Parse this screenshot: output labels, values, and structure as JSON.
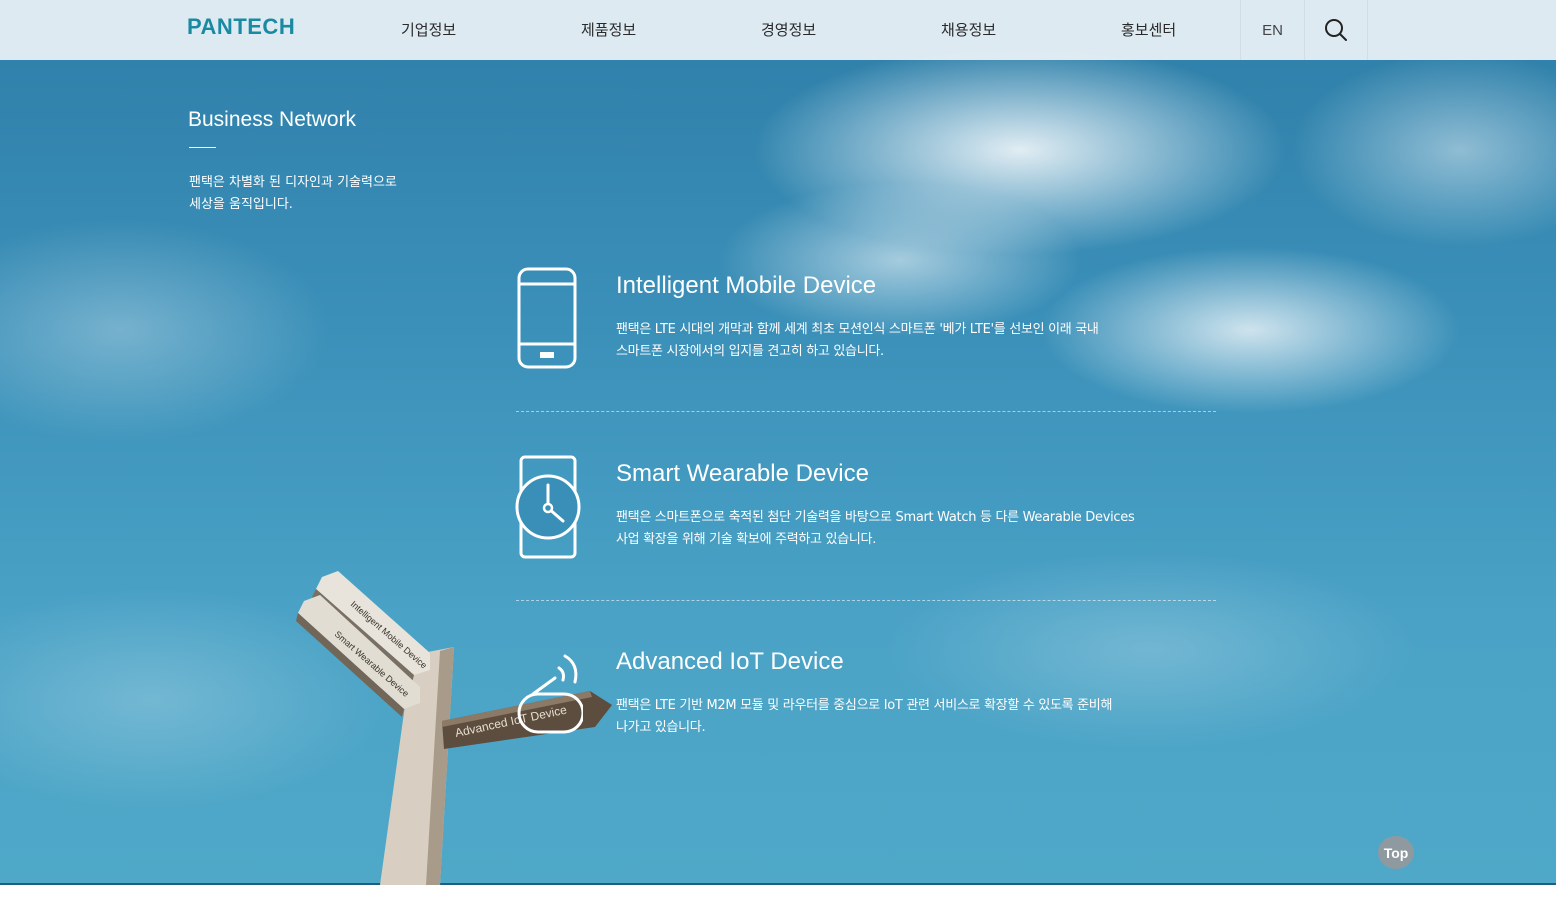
{
  "header": {
    "logo": "PANTECH",
    "nav": [
      "기업정보",
      "제품정보",
      "경영정보",
      "채용정보",
      "홍보센터"
    ],
    "lang": "EN",
    "search_icon": "search-icon"
  },
  "intro": {
    "title": "Business Network",
    "text": "팬택은 차별화 된 디자인과 기술력으로\n세상을 움직입니다."
  },
  "business": [
    {
      "icon": "smartphone-icon",
      "title": "Intelligent Mobile Device",
      "desc": "팬택은 LTE 시대의 개막과 함께 세계 최초 모션인식 스마트폰 '베가 LTE'를 선보인 이래 국내\n스마트폰 시장에서의 입지를 견고히 하고 있습니다."
    },
    {
      "icon": "smartwatch-icon",
      "title": "Smart Wearable Device",
      "desc": "팬택은 스마트폰으로 축적된 첨단 기술력을 바탕으로 Smart Watch 등 다른 Wearable Devices\n사업 확장을 위해 기술 확보에 주력하고 있습니다."
    },
    {
      "icon": "iot-device-icon",
      "title": "Advanced IoT Device",
      "desc": "팬택은 LTE 기반 M2M 모듈 및 라우터를 중심으로 IoT 관련 서비스로 확장할 수 있도록 준비해\n나가고 있습니다."
    }
  ],
  "signpost": {
    "signs": [
      "Intelligent Mobile Device",
      "Smart Wearable Device",
      "Advanced IoT Device"
    ]
  },
  "top_button": "Top",
  "colors": {
    "logo": "#1a8aa3",
    "sky": "#3a8fb8",
    "top_button": "#8f9aa0"
  }
}
